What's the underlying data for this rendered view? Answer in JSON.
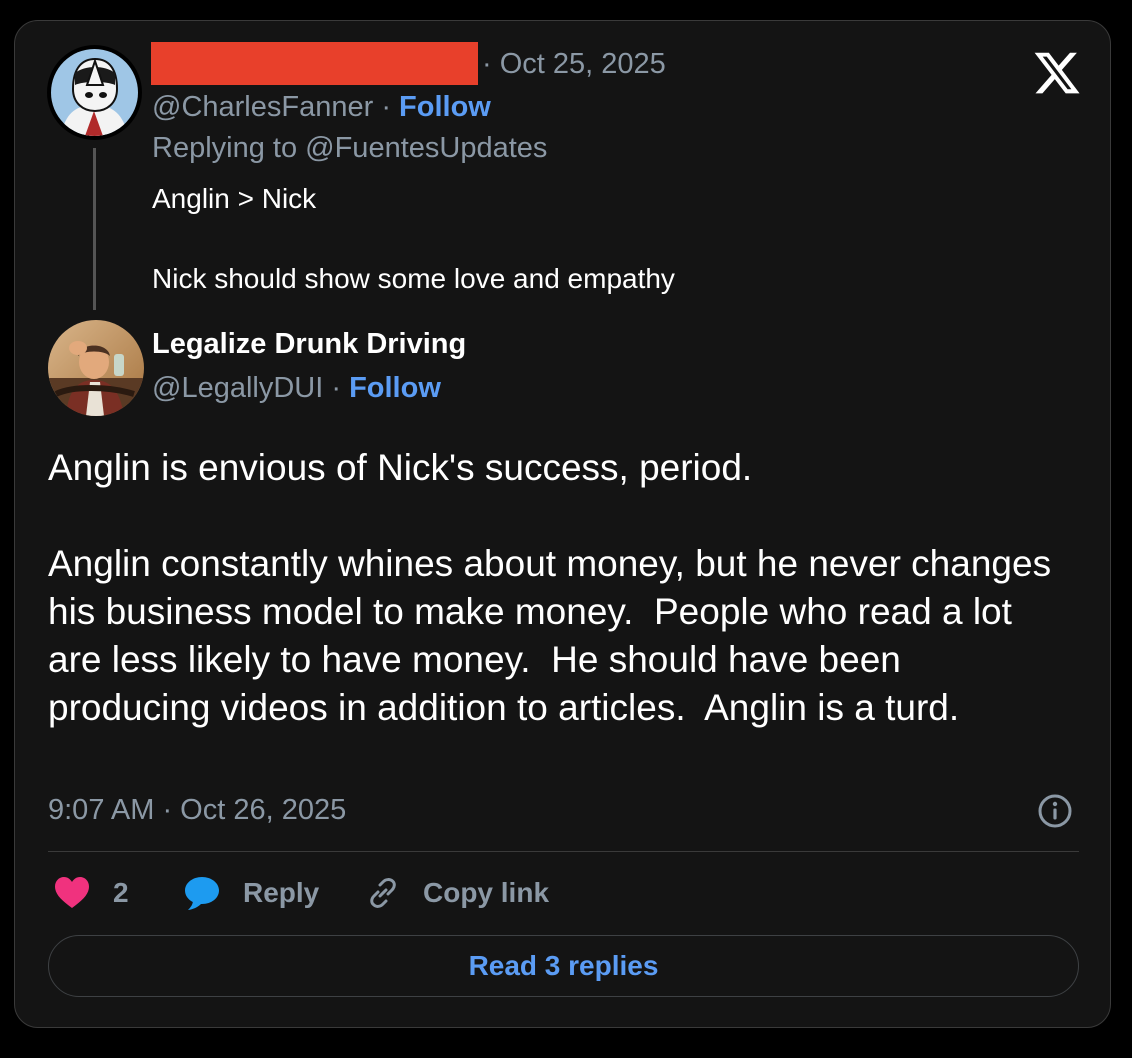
{
  "parent_tweet": {
    "date": "· Oct 25, 2025",
    "handle": "@CharlesFanner",
    "separator": " · ",
    "follow_label": "Follow",
    "replying_prefix": "Replying to ",
    "replying_to": "@FuentesUpdates",
    "text": "Anglin > Nick\n\nNick should show some love and empathy"
  },
  "main_tweet": {
    "display_name": "Legalize Drunk Driving",
    "handle": "@LegallyDUI",
    "separator": " · ",
    "follow_label": "Follow",
    "text": "Anglin is envious of Nick's success, period.\n\nAnglin constantly whines about money, but he never changes his business model to make money.  People who read a lot are less likely to have money.  He should have been producing videos in addition to articles.  Anglin is a turd.",
    "timestamp": "9:07 AM · Oct 26, 2025"
  },
  "actions": {
    "like_count": "2",
    "reply_label": "Reply",
    "copy_link_label": "Copy link"
  },
  "read_replies_label": "Read 3 replies",
  "icons": {
    "brand": "x-logo-icon",
    "like": "heart-icon",
    "reply": "speech-bubble-icon",
    "copy": "link-icon",
    "info": "info-icon"
  },
  "colors": {
    "background": "#000000",
    "card": "#141414",
    "accent": "#5b9cf4",
    "secondary_text": "#8b98a5",
    "like": "#f0327e",
    "reply_icon": "#1d9bf0",
    "redaction": "#e8402b"
  }
}
